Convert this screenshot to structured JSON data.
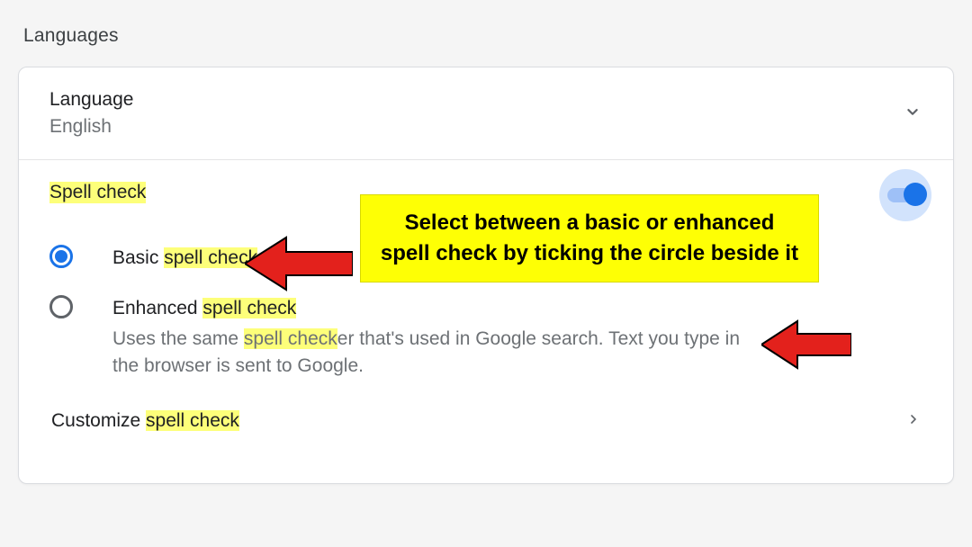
{
  "section_title": "Languages",
  "language_row": {
    "title": "Language",
    "value": "English"
  },
  "spellcheck": {
    "label": "Spell check",
    "toggle_on": true,
    "options": {
      "basic": {
        "prefix": "Basic ",
        "highlight": "spell check",
        "selected": true
      },
      "enhanced": {
        "prefix": "Enhanced ",
        "highlight": "spell check",
        "desc_before": "Uses the same ",
        "desc_highlight": "spell check",
        "desc_after": "er that's used in Google search. Text you type in the browser is sent to Google.",
        "selected": false
      }
    },
    "customize_prefix": "Customize ",
    "customize_highlight": "spell check"
  },
  "callout_text": "Select between a basic or enhanced spell check by ticking the circle beside it"
}
